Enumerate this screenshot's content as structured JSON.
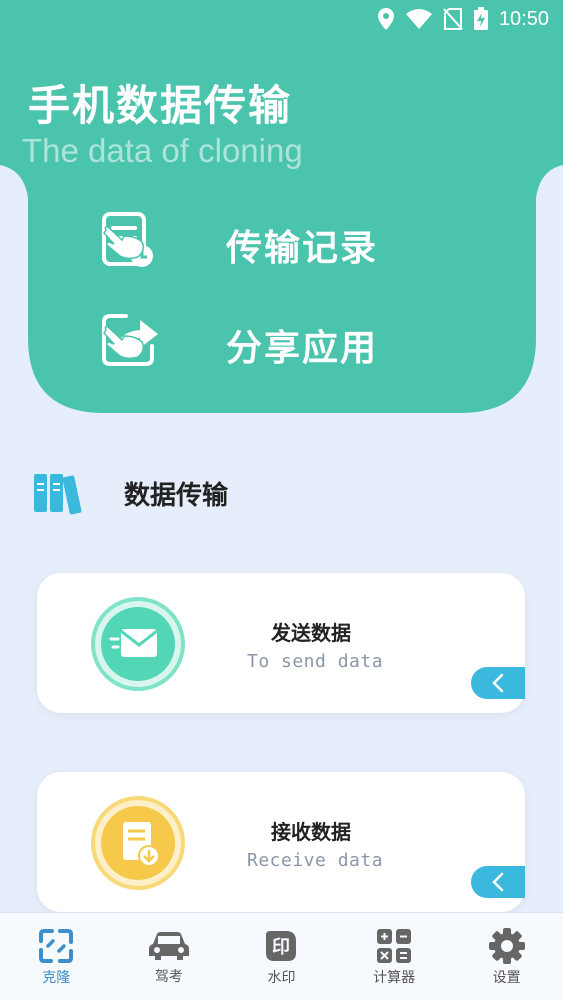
{
  "status_bar": {
    "time": "10:50"
  },
  "hero": {
    "title": "手机数据传输",
    "subtitle": "The data of cloning",
    "actions": [
      {
        "label": "传输记录",
        "icon": "document-clock-icon"
      },
      {
        "label": "分享应用",
        "icon": "share-icon"
      }
    ]
  },
  "section": {
    "title": "数据传输",
    "icon": "books-icon"
  },
  "cards": [
    {
      "title": "发送数据",
      "subtitle": "To send data",
      "icon": "envelope-icon",
      "accent": "#52d6b5"
    },
    {
      "title": "接收数据",
      "subtitle": "Receive data",
      "icon": "download-document-icon",
      "accent": "#f6c94a"
    }
  ],
  "nav": {
    "items": [
      {
        "label": "克隆",
        "icon": "clone-icon",
        "active": true
      },
      {
        "label": "驾考",
        "icon": "car-icon",
        "active": false
      },
      {
        "label": "水印",
        "icon": "watermark-icon",
        "active": false
      },
      {
        "label": "计算器",
        "icon": "calculator-icon",
        "active": false
      },
      {
        "label": "设置",
        "icon": "gear-icon",
        "active": false
      }
    ]
  },
  "colors": {
    "primary": "#4bc4ae",
    "background": "#e6eefb",
    "tab_blue": "#3bb8dd",
    "nav_active": "#3c8fc8"
  }
}
